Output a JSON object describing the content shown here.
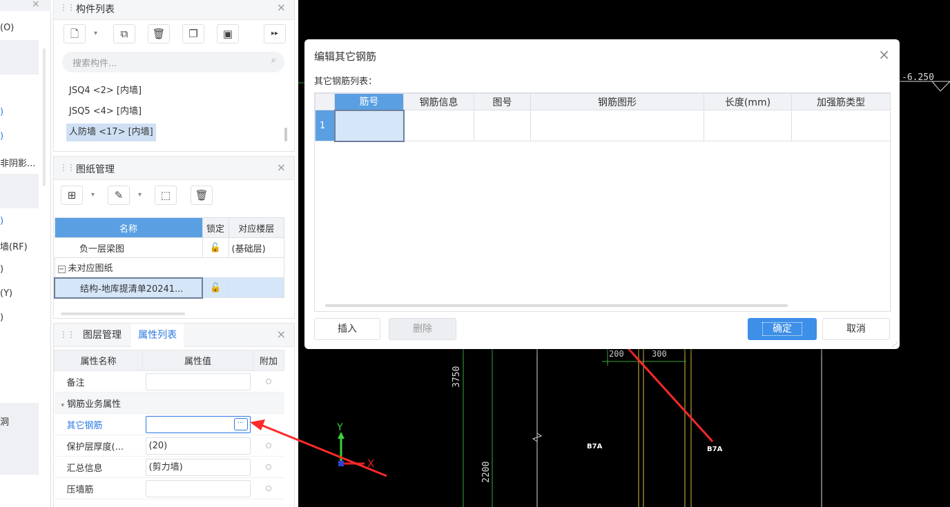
{
  "left_strip": {
    "items": [
      "(O)",
      ")",
      ")",
      "非阴影...",
      ")",
      "墙(RF)",
      ")",
      "(Y)",
      ")",
      "洞"
    ]
  },
  "component_panel": {
    "title": "构件列表",
    "search_placeholder": "搜索构件...",
    "items": [
      "JSQ4 <2> [内墙]",
      "JSQ5 <4> [内墙]",
      "人防墙 <17> [内墙]"
    ]
  },
  "drawing_panel": {
    "title": "图纸管理",
    "columns": [
      "名称",
      "锁定",
      "对应楼层"
    ],
    "rows": [
      {
        "name": "负一层梁图",
        "floor": "(基础层)"
      },
      {
        "name": "结构-地库提清单20241...",
        "floor": ""
      }
    ],
    "group_label": "未对应图纸"
  },
  "property_panel": {
    "tabs": [
      "图层管理",
      "属性列表"
    ],
    "columns": [
      "属性名称",
      "属性值",
      "附加"
    ],
    "rows": [
      {
        "name": "备注",
        "value": ""
      },
      {
        "name": "其它钢筋",
        "value": ""
      },
      {
        "name": "保护层厚度(...",
        "value": "(20)"
      },
      {
        "name": "汇总信息",
        "value": "(剪力墙)"
      },
      {
        "name": "压墙筋",
        "value": ""
      }
    ],
    "group": "钢筋业务属性"
  },
  "dialog": {
    "title": "编辑其它钢筋",
    "subtitle": "其它钢筋列表：",
    "columns": [
      "筋号",
      "钢筋信息",
      "图号",
      "钢筋图形",
      "长度(mm)",
      "加强筋类型"
    ],
    "row_numbers": [
      "1"
    ],
    "buttons": {
      "insert": "插入",
      "delete": "删除",
      "ok": "确定",
      "cancel": "取消"
    }
  },
  "cad": {
    "labels": {
      "elevation": "-6.250",
      "dim_200": "200",
      "dim_300": "300",
      "dim_3750": "3750",
      "dim_2200": "2200",
      "tag1": "B7A",
      "tag2": "B7A",
      "axis_y": "Y",
      "axis_x": "X"
    }
  },
  "colors": {
    "accent": "#2a7ae2",
    "header_blue": "#5b9fe3",
    "arrow": "#ff2a2a"
  }
}
